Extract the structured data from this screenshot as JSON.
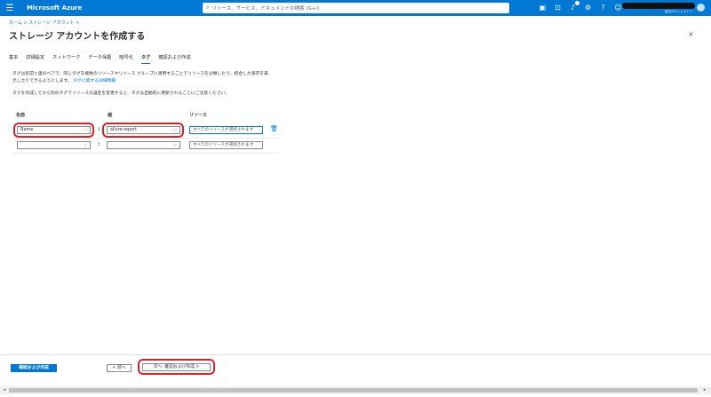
{
  "topbar": {
    "brand": "Microsoft Azure",
    "search_placeholder": "リソース、サービス、ドキュメントの検索 (G+/)",
    "account_sub": "既定のディレクトリ"
  },
  "breadcrumb": "ホーム > ストレージ アカウント >",
  "page_title": "ストレージ アカウントを作成する",
  "more_glyph": "···",
  "close_glyph": "×",
  "tabs": [
    {
      "label": "基本"
    },
    {
      "label": "詳細設定"
    },
    {
      "label": "ネットワーク"
    },
    {
      "label": "データ保護"
    },
    {
      "label": "暗号化"
    },
    {
      "label": "タグ",
      "active": true
    },
    {
      "label": "確認および作成"
    }
  ],
  "description": {
    "text": "タグは名前と値のペアで、同じタグを複数のリソースやリソース グループに適用することでリソースを分類したり、統合した請求を表示したりできるようにします。",
    "link": "タグに関する詳細情報",
    "note": "タグを作成してから別のタグでリソースの設定を変更すると、タグは自動的に更新されることにご注意ください。"
  },
  "columns": {
    "name": "名前",
    "value": "値",
    "resource": "リソース"
  },
  "rows": [
    {
      "name": "Name",
      "value": "allure-report",
      "resource": "すべてのリソースが選択されます"
    },
    {
      "name": "",
      "value": "",
      "resource": "すべてのリソースが選択されます"
    }
  ],
  "colon": ":",
  "footer": {
    "review_create": "確認および作成",
    "prev": "< 前へ",
    "next": "次へ: 確認および作成 >"
  },
  "colors": {
    "accent": "#0078d4",
    "highlight": "#d9222a"
  }
}
